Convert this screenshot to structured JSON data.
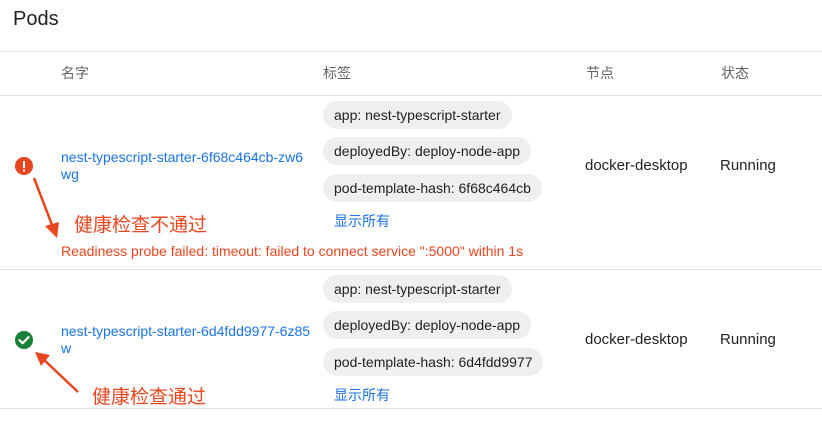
{
  "page": {
    "title": "Pods"
  },
  "table": {
    "headers": {
      "name": "名字",
      "labels": "标签",
      "node": "节点",
      "status": "状态"
    },
    "rows": [
      {
        "status_icon": "error-icon",
        "name": "nest-typescript-starter-6f68c464cb-zw6wg",
        "labels": [
          "app: nest-typescript-starter",
          "deployedBy: deploy-node-app",
          "pod-template-hash: 6f68c464cb"
        ],
        "show_all": "显示所有",
        "node": "docker-desktop",
        "status": "Running",
        "error_message": "Readiness probe failed: timeout: failed to connect service \":5000\" within 1s",
        "annotation": "健康检查不通过"
      },
      {
        "status_icon": "check-circle-icon",
        "name": "nest-typescript-starter-6d4fdd9977-6z85w",
        "labels": [
          "app: nest-typescript-starter",
          "deployedBy: deploy-node-app",
          "pod-template-hash: 6d4fdd9977"
        ],
        "show_all": "显示所有",
        "node": "docker-desktop",
        "status": "Running",
        "annotation": "健康检查通过"
      }
    ]
  },
  "colors": {
    "error": "#e8461f",
    "success": "#188038",
    "link": "#1a73e8",
    "chip": "#efefef"
  }
}
